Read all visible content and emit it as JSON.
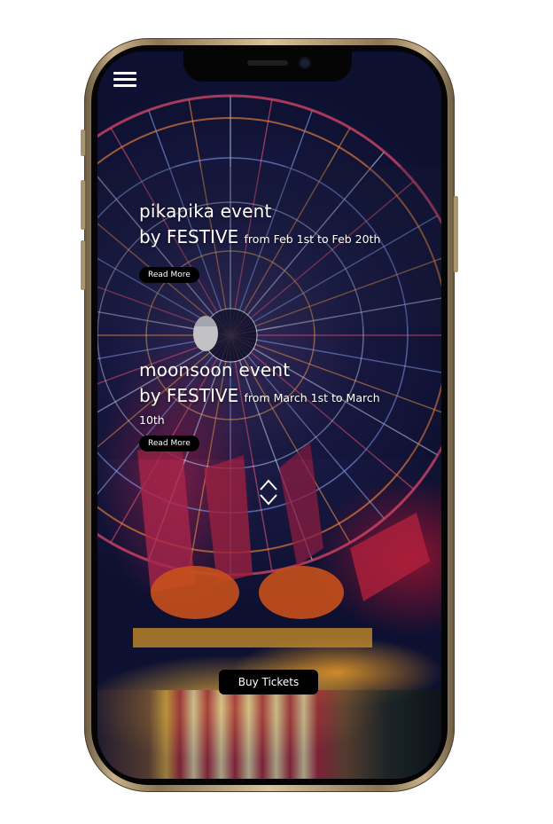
{
  "app": {
    "menu_icon": "hamburger-menu-icon",
    "scroll_icon": "chevron-up-down-icon"
  },
  "events": [
    {
      "title": "pikapika event",
      "by": "by FESTIVE",
      "date_text": "from Feb 1st to Feb 20th",
      "read_more": "Read More"
    },
    {
      "title": "moonsoon event",
      "by": "by FESTIVE",
      "date_text": "from March 1st to March 10th",
      "read_more": "Read More"
    }
  ],
  "cta": {
    "buy_tickets": "Buy Tickets"
  },
  "colors": {
    "button_bg": "#000000",
    "text": "#ffffff",
    "phone_frame": "#c9b28a"
  }
}
